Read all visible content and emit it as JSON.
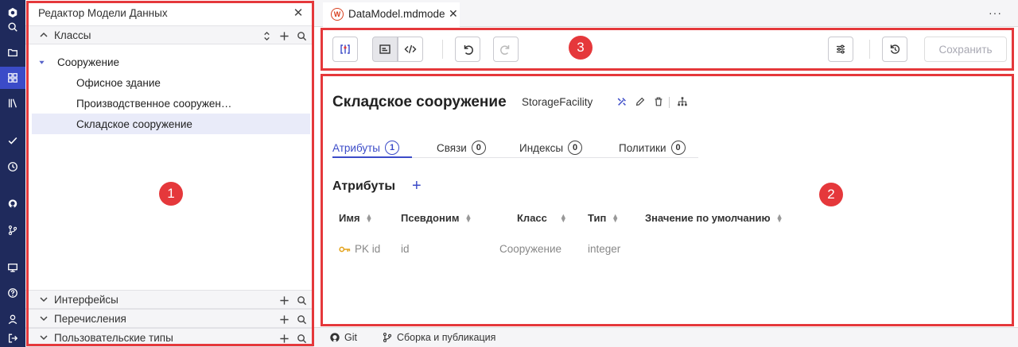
{
  "sidebar": {
    "title": "Редактор Модели Данных",
    "close_glyph": "✕",
    "sections": {
      "classes": "Классы",
      "interfaces": "Интерфейсы",
      "enums": "Перечисления",
      "user_types": "Пользовательские типы"
    },
    "tree": {
      "root": "Сооружение",
      "children": [
        "Офисное здание",
        "Производственное сооружен…",
        "Складское сооружение"
      ]
    }
  },
  "editor_tab": {
    "icon_letter": "W",
    "title": "DataModel.mdmodel",
    "close_glyph": "✕",
    "more_glyph": "···"
  },
  "toolbar": {
    "save_label": "Сохранить"
  },
  "content": {
    "class_title": "Складское сооружение",
    "class_name": "StorageFacility",
    "tabs": [
      {
        "label": "Атрибуты",
        "count": "1"
      },
      {
        "label": "Связи",
        "count": "0"
      },
      {
        "label": "Индексы",
        "count": "0"
      },
      {
        "label": "Политики",
        "count": "0"
      }
    ],
    "attributes_title": "Атрибуты",
    "add_glyph": "+",
    "columns": [
      "Имя",
      "Псевдоним",
      "Класс",
      "Тип",
      "Значение по умолчанию"
    ],
    "rows": [
      {
        "name": "PK id",
        "alias": "id",
        "class": "Сооружение",
        "type": "integer"
      }
    ]
  },
  "statusbar": {
    "git": "Git",
    "build": "Сборка и публикация"
  },
  "annotations": [
    "1",
    "2",
    "3"
  ],
  "colors": {
    "accent": "#3b4bc8",
    "activity_bar": "#1f2a5c",
    "annotation": "#e5383b"
  }
}
